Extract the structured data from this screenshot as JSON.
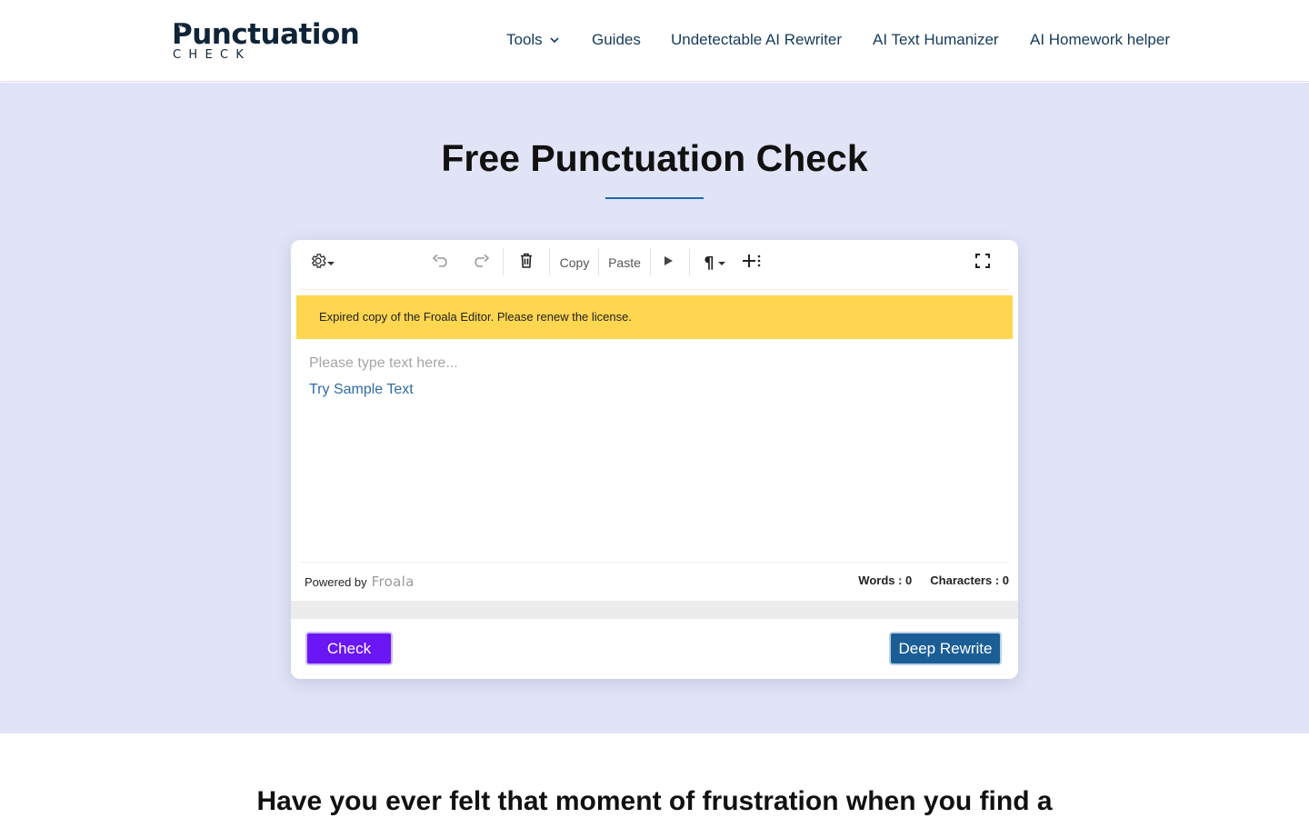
{
  "header": {
    "logo": {
      "main": "Punctuation",
      "sub": "CHECK"
    },
    "nav": [
      {
        "label": "Tools",
        "has_dropdown": true
      },
      {
        "label": "Guides"
      },
      {
        "label": "Undetectable AI Rewriter"
      },
      {
        "label": "AI Text Humanizer"
      },
      {
        "label": "AI Homework helper"
      }
    ]
  },
  "hero": {
    "title": "Free Punctuation Check"
  },
  "editor": {
    "toolbar": {
      "copy_label": "Copy",
      "paste_label": "Paste",
      "icons": [
        "gear-icon",
        "undo-icon",
        "redo-icon",
        "trash-icon",
        "play-icon",
        "paragraph-icon",
        "insert-more-icon",
        "fullscreen-icon"
      ]
    },
    "license_notice": "Expired copy of the Froala Editor. Please renew the license.",
    "placeholder": "Please type text here...",
    "sample_link": "Try Sample Text",
    "powered_by": "Powered by",
    "brand": "Froala",
    "words_label": "Words : 0",
    "characters_label": "Characters : 0"
  },
  "actions": {
    "check_label": "Check",
    "deep_rewrite_label": "Deep Rewrite"
  },
  "content": {
    "heading_partial": "Have you ever felt that moment of frustration when you find a"
  },
  "colors": {
    "hero_bg": "#e1e4f6",
    "accent_line": "#1f6aa8",
    "license_bg": "#fed650",
    "check_button": "#6a16f5",
    "rewrite_button": "#1b5e96",
    "nav_text": "#163a5c"
  }
}
